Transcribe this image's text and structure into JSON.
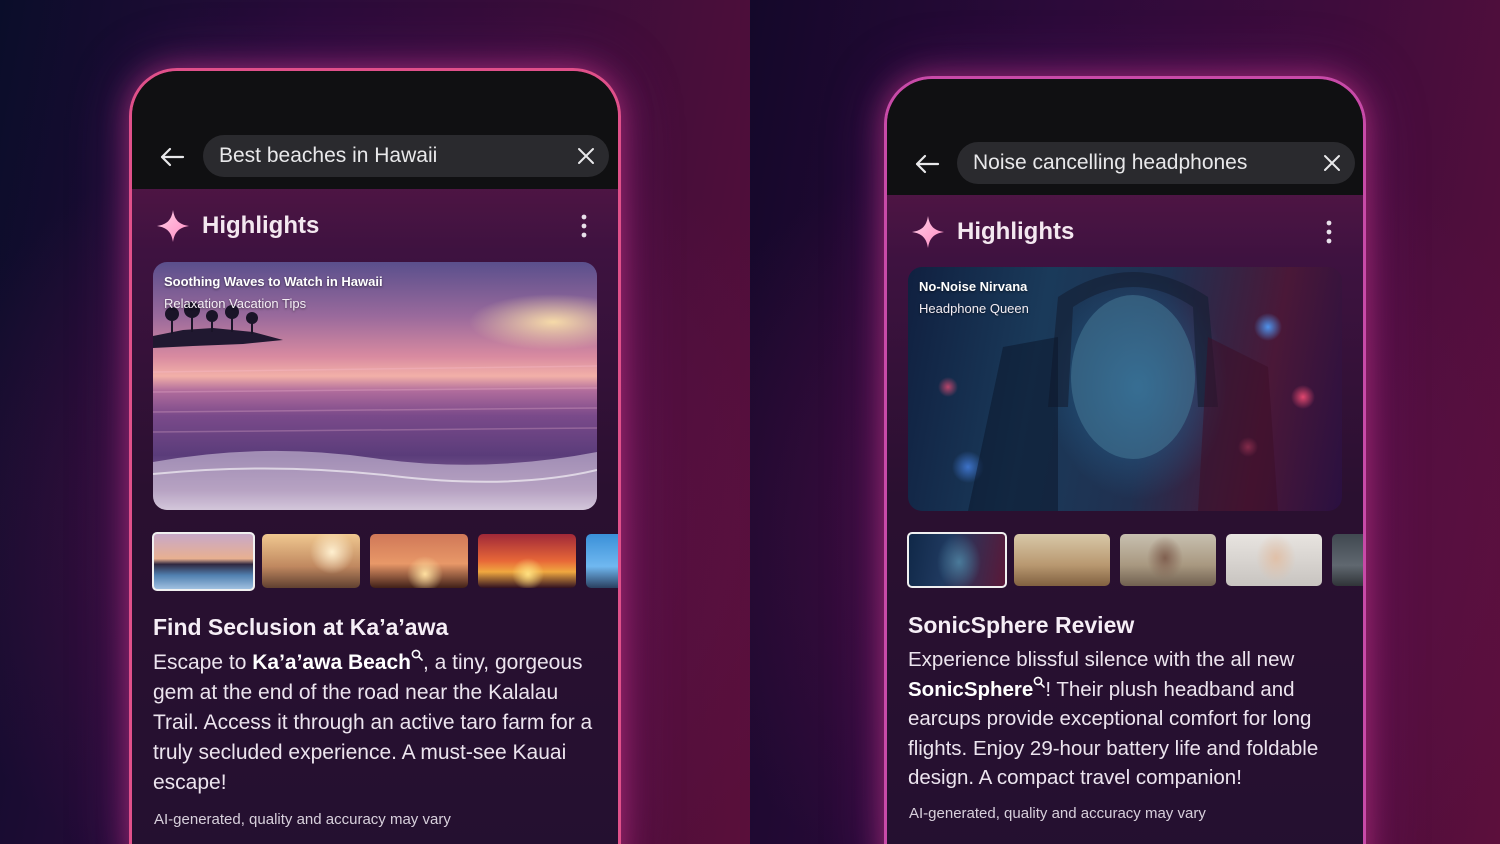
{
  "left": {
    "search": {
      "query": "Best beaches in Hawaii"
    },
    "highlights": {
      "title": "Highlights"
    },
    "hero": {
      "title": "Soothing Waves to Watch in Hawaii",
      "subtitle": "Relaxation Vacation Tips"
    },
    "article": {
      "title": "Find Seclusion at Ka’a’awa",
      "intro": "Escape to ",
      "link": "Ka’a’awa Beach",
      "rest": ", a tiny, gorgeous gem at the end of the road near the Kalalau Trail. Access it through an active taro farm for a truly secluded experience. A must-see Kauai escape!"
    },
    "disclaimer": "AI-generated, quality and accuracy may vary"
  },
  "right": {
    "search": {
      "query": "Noise cancelling headphones"
    },
    "highlights": {
      "title": "Highlights"
    },
    "hero": {
      "title": "No-Noise Nirvana",
      "subtitle": "Headphone Queen"
    },
    "article": {
      "title": "SonicSphere Review",
      "intro": "Experience blissful silence with the all new ",
      "link": "SonicSphere",
      "rest": "! Their plush headband and earcups provide exceptional comfort for long flights. Enjoy 29-hour battery life and foldable design. A compact travel companion!"
    },
    "disclaimer": "AI-generated, quality and accuracy may vary"
  },
  "icons": {
    "back": "arrow-left-icon",
    "clear": "close-icon",
    "sparkle": "sparkle-icon",
    "more": "more-vertical-icon",
    "search_hint": "magnifier-icon"
  },
  "colors": {
    "accent_pink": "#e0508a",
    "accent_purple": "#c84aa8",
    "topbar": "#101012"
  }
}
